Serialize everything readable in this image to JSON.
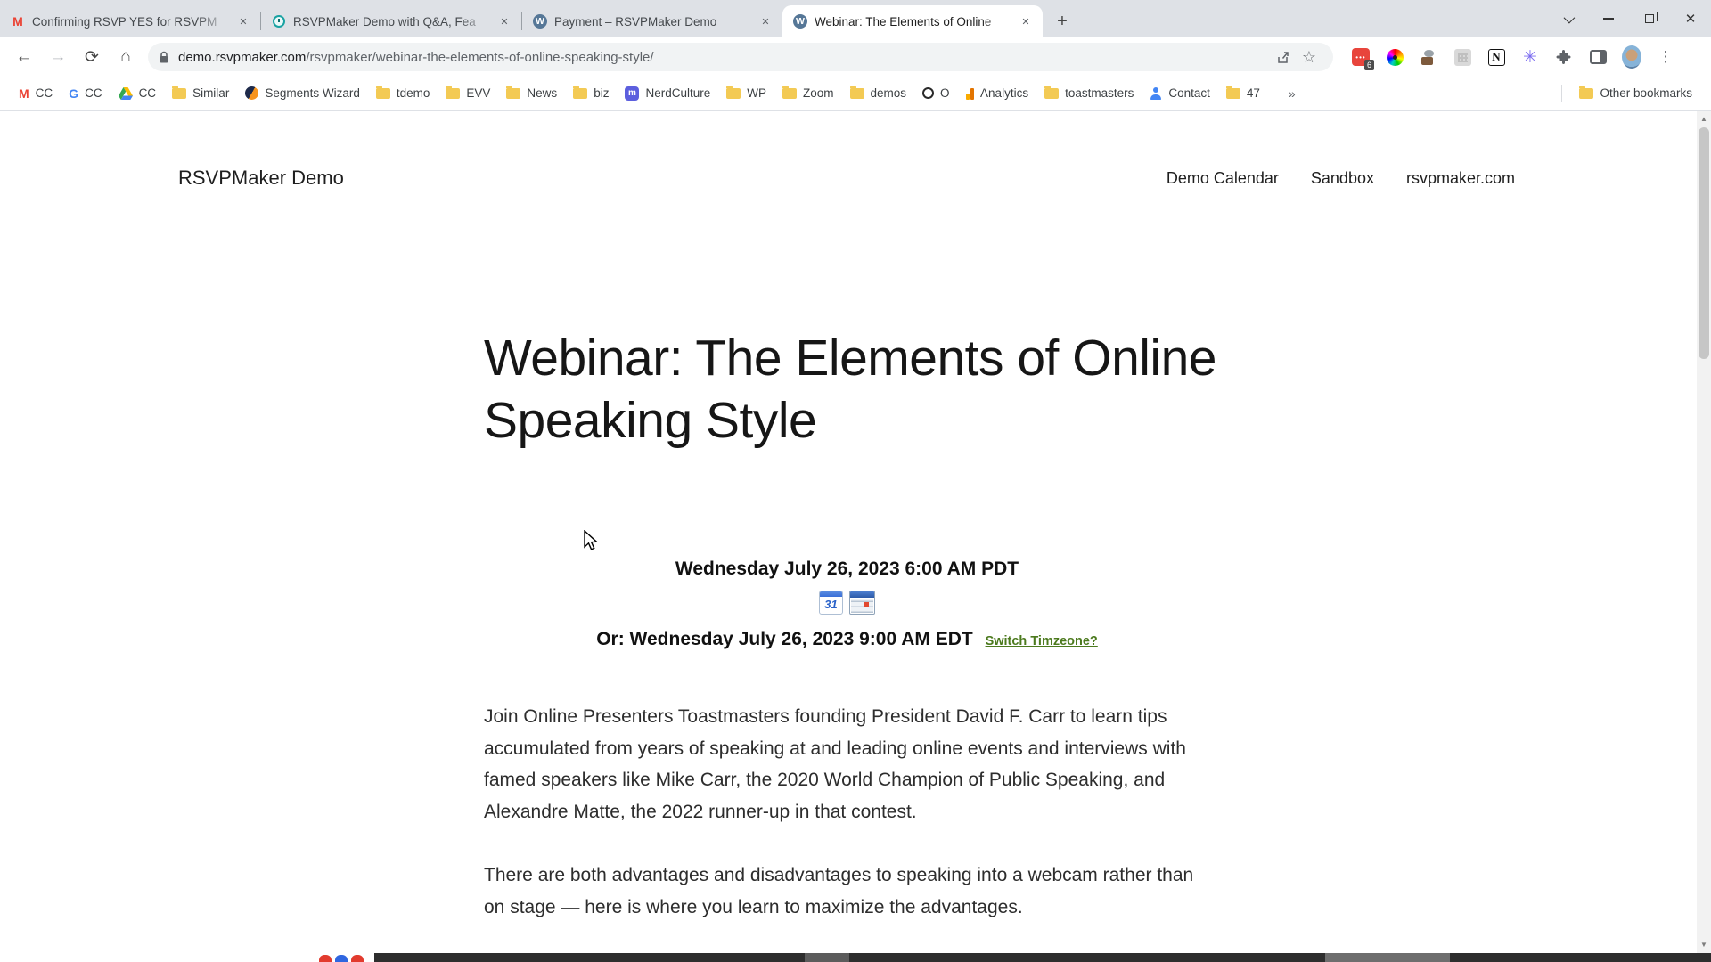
{
  "browser": {
    "tabs": [
      {
        "title": "Confirming RSVP YES for RSVPM",
        "favicon": "gmail"
      },
      {
        "title": "RSVPMaker Demo with Q&A, Fea",
        "favicon": "alarm-clock"
      },
      {
        "title": "Payment – RSVPMaker Demo",
        "favicon": "wordpress"
      },
      {
        "title": "Webinar: The Elements of Online",
        "favicon": "wordpress"
      }
    ],
    "url_host": "demo.rsvpmaker.com",
    "url_path": "/rsvpmaker/webinar-the-elements-of-online-speaking-style/",
    "extension_badge": "6",
    "glyphs": {
      "gmail": "M",
      "wordpress": "W",
      "google": "G",
      "notion": "N",
      "mastodon": "m",
      "back": "←",
      "forward": "→",
      "reload": "⟳",
      "home": "⌂",
      "star": "☆",
      "plus": "+",
      "close": "✕",
      "asterisk": "✳",
      "menu_dots": "⋮",
      "ext_dots": "•••",
      "up_arrow": "▲",
      "down_arrow": "▼"
    }
  },
  "bookmarks": {
    "labels": [
      "CC",
      "CC",
      "CC",
      "Similar",
      "Segments Wizard",
      "tdemo",
      "EVV",
      "News",
      "biz",
      "NerdCulture",
      "WP",
      "Zoom",
      "demos",
      "O",
      "Analytics",
      "toastmasters",
      "Contact",
      "47"
    ],
    "overflow": "»",
    "other": "Other bookmarks"
  },
  "page": {
    "site_title": "RSVPMaker Demo",
    "nav": [
      "Demo Calendar",
      "Sandbox",
      "rsvpmaker.com"
    ],
    "heading": "Webinar: The Elements of Online Speaking Style",
    "event": {
      "primary_time": "Wednesday July 26, 2023 6:00 AM PDT",
      "alt_time": "Or: Wednesday July 26, 2023 9:00 AM EDT",
      "switch_link": "Switch Timzeone?",
      "gcal_day": "31"
    },
    "paragraphs": [
      "Join Online Presenters Toastmasters founding President David F. Carr to learn tips accumulated from years of speaking at and leading online events and interviews with famed speakers like Mike Carr, the 2020 World Champion of Public Speaking, and Alexandre Matte, the 2022 runner-up in that contest.",
      "There are both advantages and disadvantages to speaking into a webcam rather than on stage — here is where you learn to maximize the advantages."
    ]
  }
}
